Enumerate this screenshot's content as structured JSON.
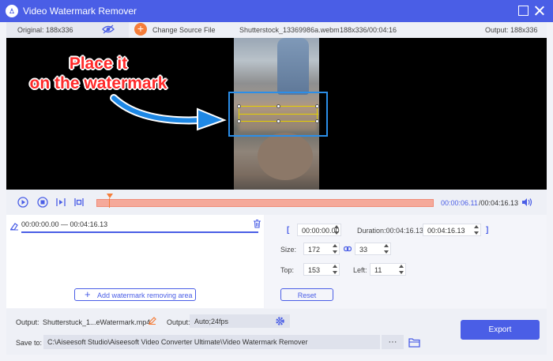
{
  "window": {
    "title": "Video Watermark Remover"
  },
  "infobar": {
    "original_label": "Original: 188x336",
    "change_source_label": "Change Source File",
    "file_name": "Shutterstock_13369986a.webm",
    "file_meta": "188x336/00:04:16",
    "output_label": "Output: 188x336"
  },
  "preview": {
    "callout_line1": "Place it",
    "callout_line2": "on the watermark"
  },
  "playback": {
    "current_time": "00:00:06.11",
    "total_time": "/00:04:16.13"
  },
  "areas": {
    "range_label": "00:00:00.00 — 00:04:16.13",
    "add_button_label": "Add watermark removing area"
  },
  "area_settings": {
    "start_time": "00:00:00.00",
    "duration_label": "Duration:00:04:16.13",
    "end_time": "00:04:16.13",
    "size_label": "Size:",
    "width": "172",
    "height": "33",
    "top_label": "Top:",
    "top": "153",
    "left_label": "Left:",
    "left": "11",
    "reset_label": "Reset"
  },
  "bottom": {
    "output_label": "Output:",
    "output_file": "Shutterstuck_1...eWatermark.mp4",
    "format_label": "Output:",
    "format_value": "Auto;24fps",
    "save_label": "Save to:",
    "save_path": "C:\\Aiseesoft Studio\\Aiseesoft Video Converter Ultimate\\Video Watermark Remover",
    "browse_label": "···",
    "export_label": "Export"
  },
  "colors": {
    "accent": "#4a5ee6",
    "callout": "#ff2a2a",
    "timeline": "#f5a99a",
    "selection": "#2b8ee8"
  }
}
